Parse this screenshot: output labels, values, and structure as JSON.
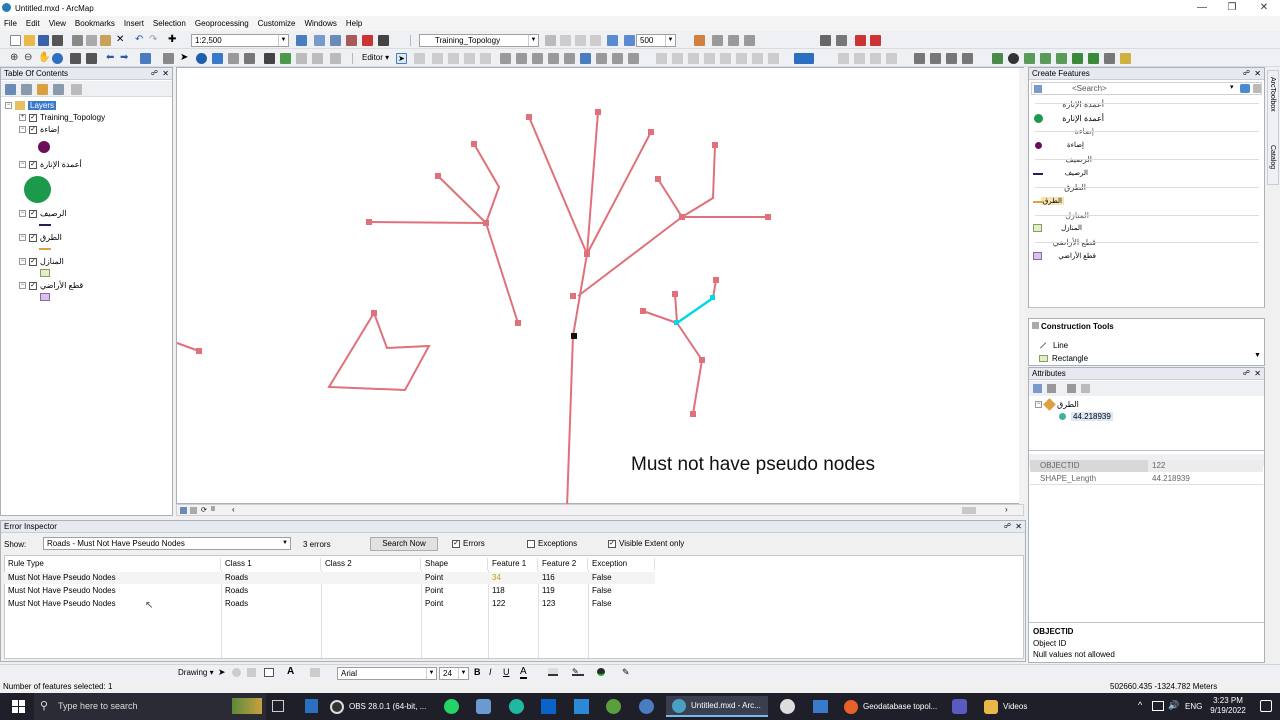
{
  "window": {
    "title": "Untitled.mxd - ArcMap"
  },
  "menu": [
    "File",
    "Edit",
    "View",
    "Bookmarks",
    "Insert",
    "Selection",
    "Geoprocessing",
    "Customize",
    "Windows",
    "Help"
  ],
  "toolbar": {
    "scale": "1:2,500",
    "topology": "Training_Topology",
    "zoom": "500",
    "editor": "Editor"
  },
  "toc": {
    "title": "Table Of Contents",
    "root": "Layers",
    "layers": [
      "Training_Topology",
      "إضاءة",
      "أعمدة الإنارة",
      "الرصيف",
      "الطرق",
      "المنازل",
      "قطع الأراضي"
    ]
  },
  "map": {
    "overlay_text": "Must not have pseudo nodes"
  },
  "create_features": {
    "title": "Create Features",
    "search_placeholder": "<Search>",
    "groups": [
      {
        "header": "أعمدة الإنارة",
        "item": "أعمدة الإنارة"
      },
      {
        "header": "إضاءة",
        "item": "إضاءة"
      },
      {
        "header": "الرصيف",
        "item": "الرصيف"
      },
      {
        "header": "الطرق",
        "item": "الطرق"
      },
      {
        "header": "المنازل",
        "item": "المنازل"
      },
      {
        "header": "قطع الأراضي",
        "item": "قطع الأراضي"
      }
    ]
  },
  "construction": {
    "title": "Construction Tools",
    "tools": [
      "Line",
      "Rectangle"
    ]
  },
  "attributes": {
    "title": "Attributes",
    "layer": "الطرق",
    "value": "44.218939",
    "rows": [
      {
        "field": "OBJECTID",
        "value": "122"
      },
      {
        "field": "SHAPE_Length",
        "value": "44.218939"
      }
    ],
    "info_title": "OBJECTID",
    "info_line1": "Object ID",
    "info_line2": "Null values not allowed"
  },
  "side_tabs": [
    "ArcToolbox",
    "Catalog"
  ],
  "error_inspector": {
    "title": "Error Inspector",
    "show_label": "Show:",
    "show_value": "Roads - Must Not Have Pseudo Nodes",
    "count": "3 errors",
    "search_button": "Search Now",
    "errors_label": "Errors",
    "exceptions_label": "Exceptions",
    "visible_label": "Visible Extent only",
    "columns": [
      "Rule Type",
      "Class 1",
      "Class 2",
      "Shape",
      "Feature 1",
      "Feature 2",
      "Exception"
    ],
    "rows": [
      [
        "Must Not Have Pseudo Nodes",
        "Roads",
        "",
        "Point",
        "34",
        "116",
        "False"
      ],
      [
        "Must Not Have Pseudo Nodes",
        "Roads",
        "",
        "Point",
        "118",
        "119",
        "False"
      ],
      [
        "Must Not Have Pseudo Nodes",
        "Roads",
        "",
        "Point",
        "122",
        "123",
        "False"
      ]
    ]
  },
  "drawing": {
    "label": "Drawing",
    "font": "Arial",
    "size": "24"
  },
  "status": {
    "selected": "Number of features selected: 1",
    "coords": "502660.435  -1324.782 Meters"
  },
  "taskbar": {
    "search": "Type here to search",
    "apps": [
      "OBS 28.0.1 (64-bit, ...",
      "Untitled.mxd - Arc...",
      "Geodatabase topol...",
      "Videos"
    ],
    "lang": "ENG",
    "time": "3:23 PM",
    "date": "9/19/2022"
  },
  "colors": {
    "accent": "#0078d7",
    "road": "#e0707a",
    "selected": "#00d8e8"
  }
}
